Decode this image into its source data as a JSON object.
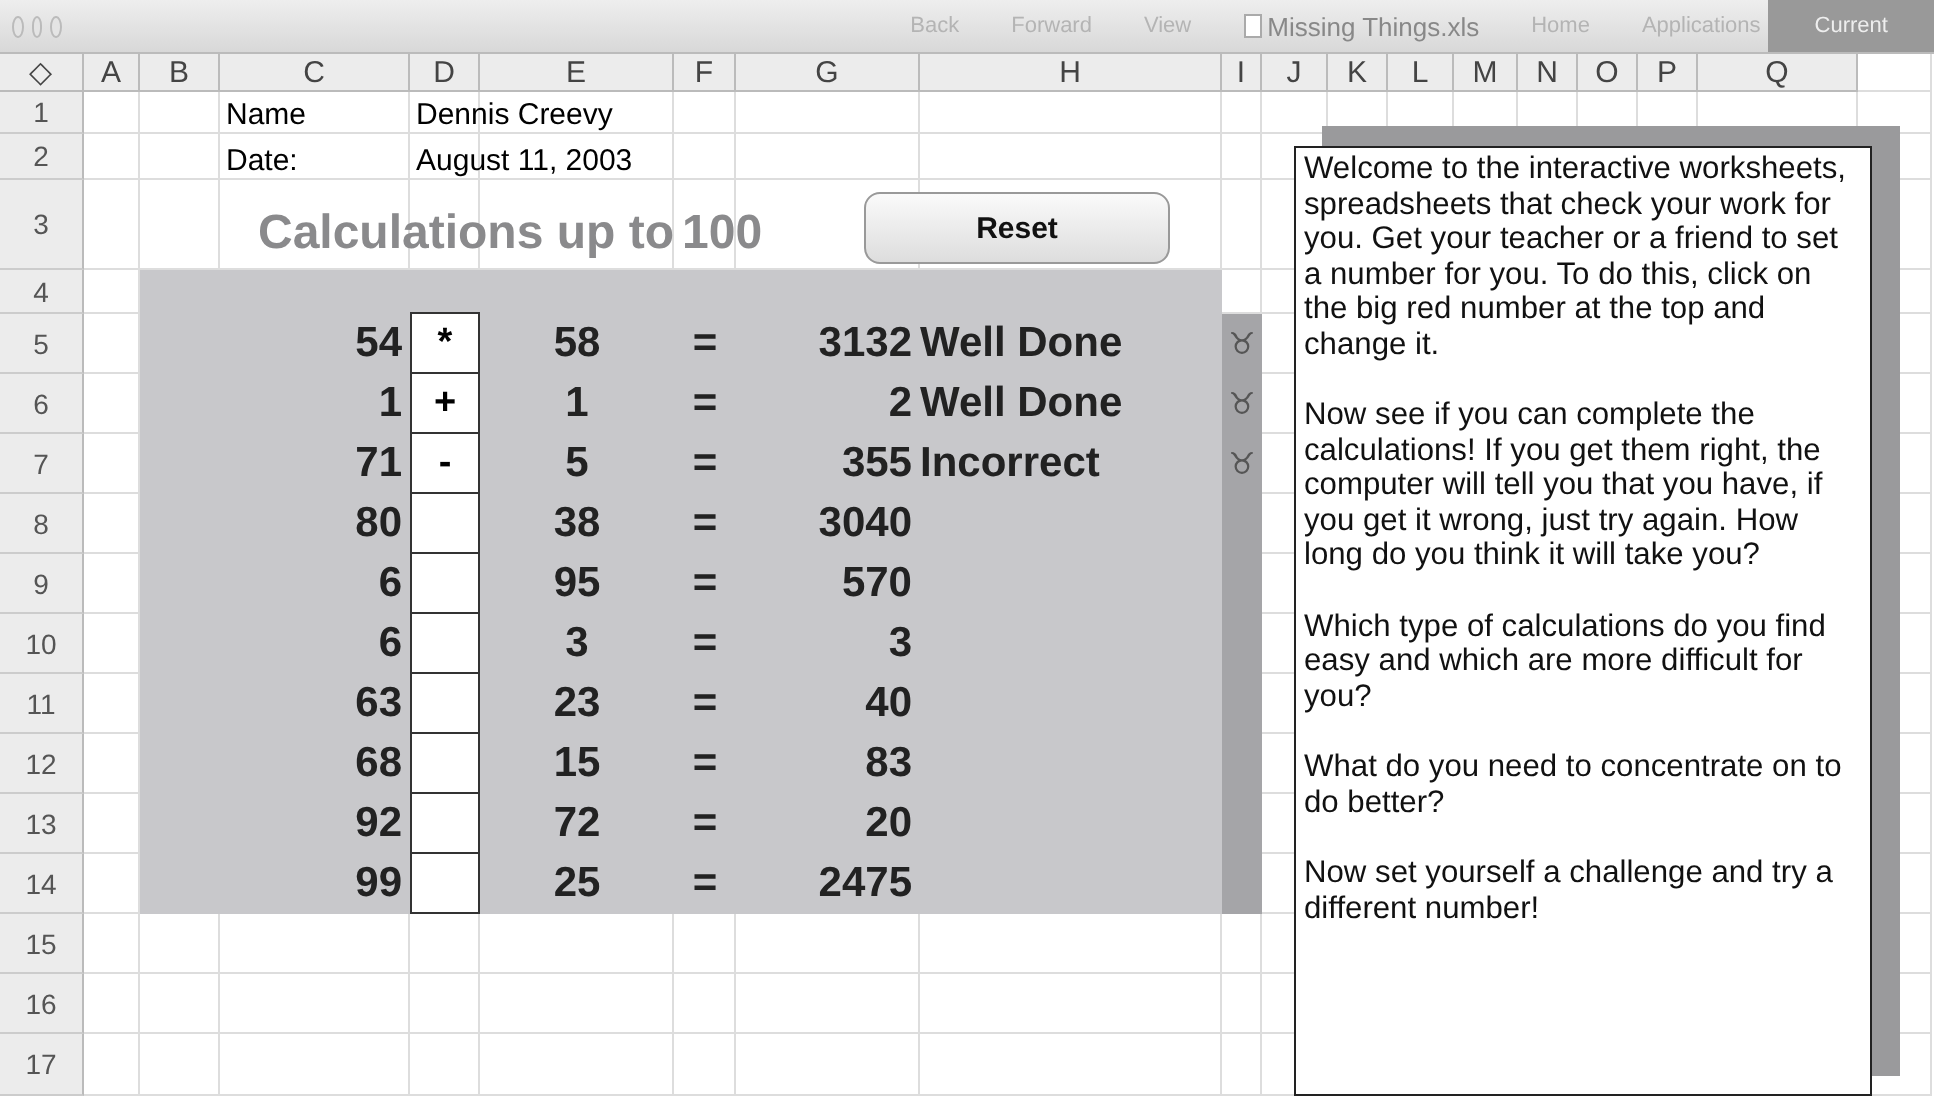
{
  "window": {
    "title": "Missing Things.xls",
    "toolbar": [
      "Back",
      "Forward",
      "View",
      "Home",
      "Applications"
    ],
    "right_label": "Current"
  },
  "select_all": "◇",
  "columns": [
    "A",
    "B",
    "C",
    "D",
    "E",
    "F",
    "G",
    "H",
    "I",
    "J",
    "K",
    "L",
    "M",
    "N",
    "O",
    "P",
    "Q"
  ],
  "rows": [
    "1",
    "2",
    "3",
    "4",
    "5",
    "6",
    "7",
    "8",
    "9",
    "10",
    "11",
    "12",
    "13",
    "14",
    "15",
    "16",
    "17"
  ],
  "name_label": "Name",
  "name_value": "Dennis Creevy",
  "date_label": "Date:",
  "date_value": "August 11, 2003",
  "heading": "Calculations up to",
  "limit": "100",
  "reset_button": "Reset",
  "problems": [
    {
      "a": "54",
      "op": "*",
      "b": "58",
      "eq": "=",
      "answer": "3132",
      "feedback": "Well Done",
      "mark": "♉"
    },
    {
      "a": "1",
      "op": "+",
      "b": "1",
      "eq": "=",
      "answer": "2",
      "feedback": "Well Done",
      "mark": "♉"
    },
    {
      "a": "71",
      "op": "-",
      "b": "5",
      "eq": "=",
      "answer": "355",
      "feedback": "Incorrect",
      "mark": "♉"
    },
    {
      "a": "80",
      "b": "38",
      "eq": "=",
      "answer": "3040"
    },
    {
      "a": "6",
      "b": "95",
      "eq": "=",
      "answer": "570"
    },
    {
      "a": "6",
      "b": "3",
      "eq": "=",
      "answer": "3"
    },
    {
      "a": "63",
      "b": "23",
      "eq": "=",
      "answer": "40"
    },
    {
      "a": "68",
      "b": "15",
      "eq": "=",
      "answer": "83"
    },
    {
      "a": "92",
      "b": "72",
      "eq": "=",
      "answer": "20"
    },
    {
      "a": "99",
      "b": "25",
      "eq": "=",
      "answer": "2475"
    }
  ],
  "instructions": [
    "Welcome to the interactive worksheets, spreadsheets that check your work for you. Get your teacher or a friend to set a number for you. To do this, click on the big red number at the top and change it.",
    "Now see if you can complete the calculations! If you get them right, the computer will tell you that you have, if you get it wrong, just try again. How long do you think it will take you?",
    "Which type of calculations do you find easy and which are more difficult for you?",
    "What do you need to concentrate on to do better?",
    "Now set yourself a challenge and try a different number!"
  ]
}
